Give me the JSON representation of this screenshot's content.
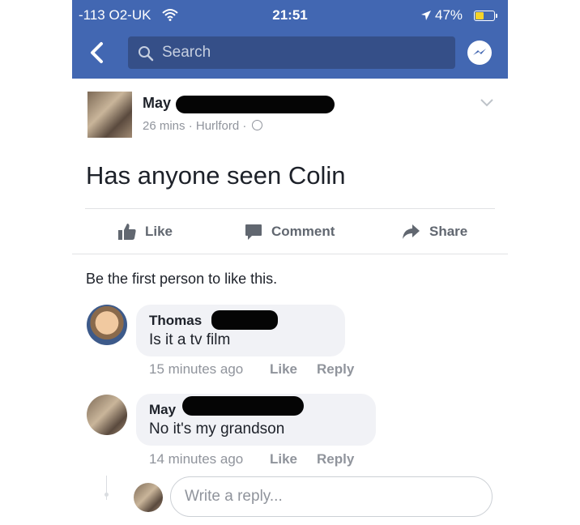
{
  "status_bar": {
    "carrier": "-113 O2-UK",
    "time": "21:51",
    "battery": "47%",
    "battery_level": 0.47,
    "icons": [
      "wifi-icon",
      "location-arrow-icon",
      "battery-icon"
    ]
  },
  "nav": {
    "search_placeholder": "Search",
    "icons": [
      "back-chevron-icon",
      "search-icon",
      "messenger-icon"
    ]
  },
  "post": {
    "author": "May",
    "time": "26 mins",
    "separator": "·",
    "location": "Hurlford",
    "text": "Has anyone seen Colin",
    "actions": {
      "like": "Like",
      "comment": "Comment",
      "share": "Share"
    }
  },
  "likes_text": "Be the first person to like this.",
  "comments": [
    {
      "author": "Thomas",
      "text": "Is it a tv film",
      "time": "15 minutes ago",
      "like": "Like",
      "reply": "Reply"
    },
    {
      "author": "May",
      "text": "No it's my grandson",
      "time": "14 minutes ago",
      "like": "Like",
      "reply": "Reply"
    }
  ],
  "reply_input": {
    "placeholder": "Write a reply..."
  },
  "colors": {
    "header": "#4267b2",
    "search_bg": "#354f88",
    "meta_text": "#90949c",
    "action_text": "#616770",
    "bubble": "#f1f2f6",
    "battery_fill": "#f5d328"
  }
}
